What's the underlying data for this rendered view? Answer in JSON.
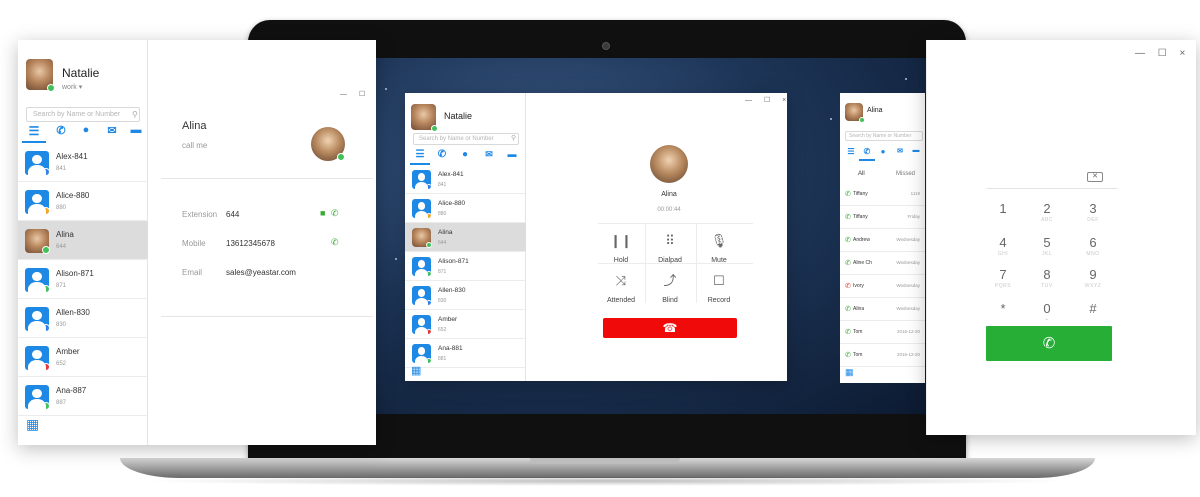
{
  "left_window": {
    "user": {
      "name": "Natalie",
      "status": "work"
    },
    "search_placeholder": "Search by Name or Number",
    "contacts": [
      {
        "name": "Alex-841",
        "ext": "841"
      },
      {
        "name": "Alice-880",
        "ext": "880"
      },
      {
        "name": "Alina",
        "ext": "644"
      },
      {
        "name": "Alison-871",
        "ext": "871"
      },
      {
        "name": "Allen-830",
        "ext": "830"
      },
      {
        "name": "Amber",
        "ext": "652"
      },
      {
        "name": "Ana-887",
        "ext": "887"
      }
    ],
    "window_buttons": "— ☐ ×",
    "detail": {
      "name": "Alina",
      "status_text": "call me",
      "fields": [
        {
          "label": "Extension",
          "value": "644"
        },
        {
          "label": "Mobile",
          "value": "13612345678"
        },
        {
          "label": "Email",
          "value": "sales@yeastar.com"
        }
      ]
    }
  },
  "center_window": {
    "user": {
      "name": "Natalie"
    },
    "search_placeholder": "Search by Name or Number",
    "contacts": [
      {
        "name": "Alex-841",
        "ext": "841"
      },
      {
        "name": "Alice-880",
        "ext": "880"
      },
      {
        "name": "Alina",
        "ext": "644"
      },
      {
        "name": "Alison-871",
        "ext": "871"
      },
      {
        "name": "Allen-830",
        "ext": "830"
      },
      {
        "name": "Amber",
        "ext": "652"
      },
      {
        "name": "Ana-881",
        "ext": "881"
      }
    ],
    "window_buttons": "— ☐ ×",
    "call": {
      "name": "Alina",
      "timer": "00:00:44",
      "controls": [
        {
          "label": "Hold",
          "icon": "pause-icon"
        },
        {
          "label": "Dialpad",
          "icon": "dialpad-icon"
        },
        {
          "label": "Mute",
          "icon": "mic-mute-icon"
        },
        {
          "label": "Attended",
          "icon": "attended-transfer-icon"
        },
        {
          "label": "Blind",
          "icon": "blind-transfer-icon"
        },
        {
          "label": "Record",
          "icon": "record-icon"
        }
      ]
    }
  },
  "right_window": {
    "user": {
      "name": "Alina"
    },
    "search_placeholder": "Search by Name or Number",
    "window_buttons": "— ☐ ×",
    "filter_tabs": [
      "All",
      "Missed"
    ],
    "history": [
      {
        "name": "Tiffany",
        "time": "1119",
        "type": "incoming"
      },
      {
        "name": "Tiffany",
        "time": "Friday",
        "type": "incoming"
      },
      {
        "name": "Andrew",
        "time": "Wednesday",
        "type": "incoming"
      },
      {
        "name": "Aline Ch",
        "time": "Wednesday",
        "type": "incoming"
      },
      {
        "name": "Ivory",
        "time": "Wednesday",
        "type": "missed"
      },
      {
        "name": "Alina",
        "time": "Wednesday",
        "type": "incoming"
      },
      {
        "name": "Tom",
        "time": "2016-12-20",
        "type": "incoming"
      },
      {
        "name": "Tom",
        "time": "2016-12-20",
        "type": "incoming"
      }
    ],
    "dialpad": {
      "backspace_icon": "backspace-icon",
      "keys": [
        {
          "n": "1",
          "s": ""
        },
        {
          "n": "2",
          "s": "ABC"
        },
        {
          "n": "3",
          "s": "DEF"
        },
        {
          "n": "4",
          "s": "GHI"
        },
        {
          "n": "5",
          "s": "JKL"
        },
        {
          "n": "6",
          "s": "MNO"
        },
        {
          "n": "7",
          "s": "PQRS"
        },
        {
          "n": "8",
          "s": "TUV"
        },
        {
          "n": "9",
          "s": "WXYZ"
        },
        {
          "n": "*",
          "s": ""
        },
        {
          "n": "0",
          "s": "+"
        },
        {
          "n": "#",
          "s": ""
        }
      ]
    }
  },
  "colors": {
    "accent": "#1e88e5",
    "hangup": "#f00a0a",
    "call": "#27ae37"
  }
}
